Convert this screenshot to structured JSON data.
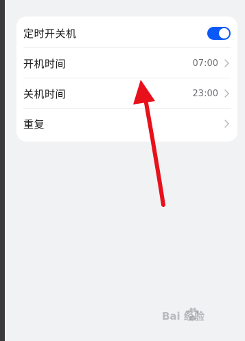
{
  "settings": {
    "auto_power": {
      "label": "定时开关机",
      "toggle_on": true
    },
    "power_on": {
      "label": "开机时间",
      "value": "07:00"
    },
    "power_off": {
      "label": "关机时间",
      "value": "23:00"
    },
    "repeat": {
      "label": "重复"
    }
  },
  "icons": {
    "chevron": "chevron-right-icon",
    "toggle": "toggle-switch",
    "annotation": "red-arrow",
    "watermark_paw": "paw-icon"
  },
  "colors": {
    "accent": "#0a59f7",
    "annotation": "#e8101a",
    "background": "#f1f2f4",
    "card": "#ffffff"
  },
  "watermark": {
    "text": "Bai 经验"
  }
}
